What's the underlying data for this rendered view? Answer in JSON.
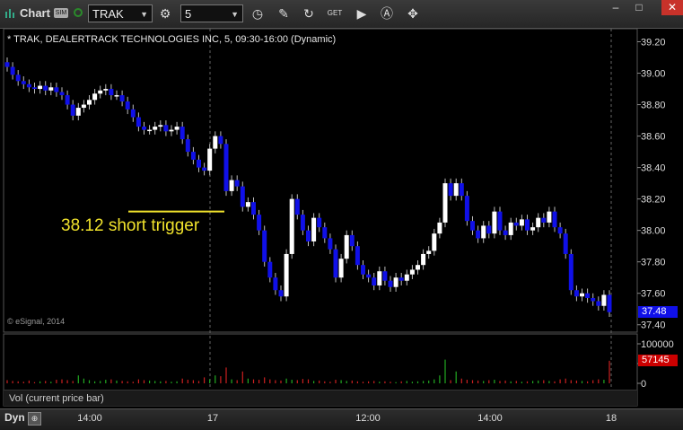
{
  "toolbar": {
    "title": "Chart",
    "sim_badge": "SIM",
    "symbol": "TRAK",
    "interval": "5",
    "icons": [
      "clock-icon",
      "pencil-icon",
      "refresh-icon",
      "get-icon",
      "play-icon",
      "alert-icon",
      "crosshair-icon"
    ],
    "window_buttons": [
      "minimize-icon",
      "maximize-icon",
      "close-icon"
    ]
  },
  "chart_header": {
    "title": "* TRAK, DEALERTRACK TECHNOLOGIES INC, 5, 09:30-16:00 (Dynamic)",
    "copyright": "© eSignal, 2014"
  },
  "annotation": {
    "text": "38.12 short trigger",
    "price": 38.12,
    "color": "#f0e22c"
  },
  "volume_panel": {
    "label": "Vol (current price bar)",
    "ticks": [
      "100000",
      "50000",
      "0"
    ],
    "current_value": "57145"
  },
  "bottom_bar": {
    "mode": "Dyn",
    "x_ticks": [
      "14:00",
      "17",
      "12:00",
      "14:00",
      "18"
    ]
  },
  "colors": {
    "up": "#ffffff",
    "down": "#1010e8",
    "vol_up": "#22aa22",
    "vol_down": "#cc2020",
    "last_price_badge": "#1010e8",
    "volume_badge": "#cc0000",
    "trigger_line": "#f0e22c"
  },
  "chart_data": {
    "type": "candlestick",
    "title": "* TRAK, DEALERTRACK TECHNOLOGIES INC, 5, 09:30-16:00 (Dynamic)",
    "ylim": [
      37.37,
      39.26
    ],
    "y_ticks": [
      "39.20",
      "39.00",
      "38.80",
      "38.60",
      "38.40",
      "38.20",
      "38.00",
      "37.80",
      "37.60",
      "37.40"
    ],
    "last_price": "37.48",
    "grid": false,
    "closes": [
      39.04,
      38.99,
      38.95,
      38.93,
      38.91,
      38.9,
      38.92,
      38.89,
      38.91,
      38.88,
      38.86,
      38.8,
      38.73,
      38.78,
      38.8,
      38.83,
      38.87,
      38.89,
      38.9,
      38.86,
      38.86,
      38.82,
      38.77,
      38.72,
      38.66,
      38.64,
      38.64,
      38.66,
      38.67,
      38.63,
      38.64,
      38.66,
      38.58,
      38.5,
      38.45,
      38.4,
      38.38,
      38.52,
      38.6,
      38.55,
      38.25,
      38.32,
      38.28,
      38.15,
      38.18,
      38.1,
      38.0,
      37.8,
      37.7,
      37.62,
      37.58,
      37.85,
      38.2,
      38.1,
      38.0,
      37.93,
      38.08,
      38.02,
      37.95,
      37.88,
      37.7,
      37.82,
      37.97,
      37.9,
      37.78,
      37.72,
      37.7,
      37.65,
      37.74,
      37.68,
      37.64,
      37.7,
      37.68,
      37.72,
      37.75,
      37.78,
      37.85,
      37.87,
      37.98,
      38.05,
      38.3,
      38.22,
      38.3,
      38.22,
      38.06,
      38.0,
      37.95,
      38.03,
      37.98,
      38.12,
      38.0,
      37.97,
      38.05,
      38.03,
      38.07,
      38.0,
      38.02,
      38.08,
      38.05,
      38.12,
      38.02,
      37.98,
      37.85,
      37.62,
      37.58,
      37.6,
      37.57,
      37.55,
      37.52,
      37.59,
      37.48
    ],
    "volumes": [
      8000,
      6000,
      5000,
      4000,
      7000,
      3000,
      5000,
      6000,
      4000,
      9000,
      10000,
      8000,
      6000,
      20000,
      12000,
      8000,
      5000,
      6000,
      9000,
      10000,
      7000,
      6000,
      5000,
      4000,
      10000,
      8000,
      7000,
      6000,
      5000,
      6000,
      4000,
      5000,
      12000,
      9000,
      8000,
      6000,
      15000,
      10000,
      20000,
      18000,
      40000,
      10000,
      8000,
      30000,
      12000,
      10000,
      9000,
      15000,
      10000,
      8000,
      7000,
      12000,
      9000,
      8000,
      11000,
      10000,
      6000,
      7000,
      5000,
      4000,
      9000,
      8000,
      6000,
      7000,
      5000,
      4000,
      5000,
      6000,
      4000,
      5000,
      4000,
      3000,
      5000,
      6000,
      4000,
      5000,
      6000,
      7000,
      10000,
      20000,
      60000,
      8000,
      30000,
      12000,
      9000,
      8000,
      7000,
      6000,
      8000,
      9000,
      6000,
      7000,
      5000,
      6000,
      4000,
      5000,
      6000,
      7000,
      8000,
      6000,
      5000,
      10000,
      12000,
      8000,
      7000,
      6000,
      5000,
      8000,
      10000,
      9000,
      57145
    ]
  }
}
